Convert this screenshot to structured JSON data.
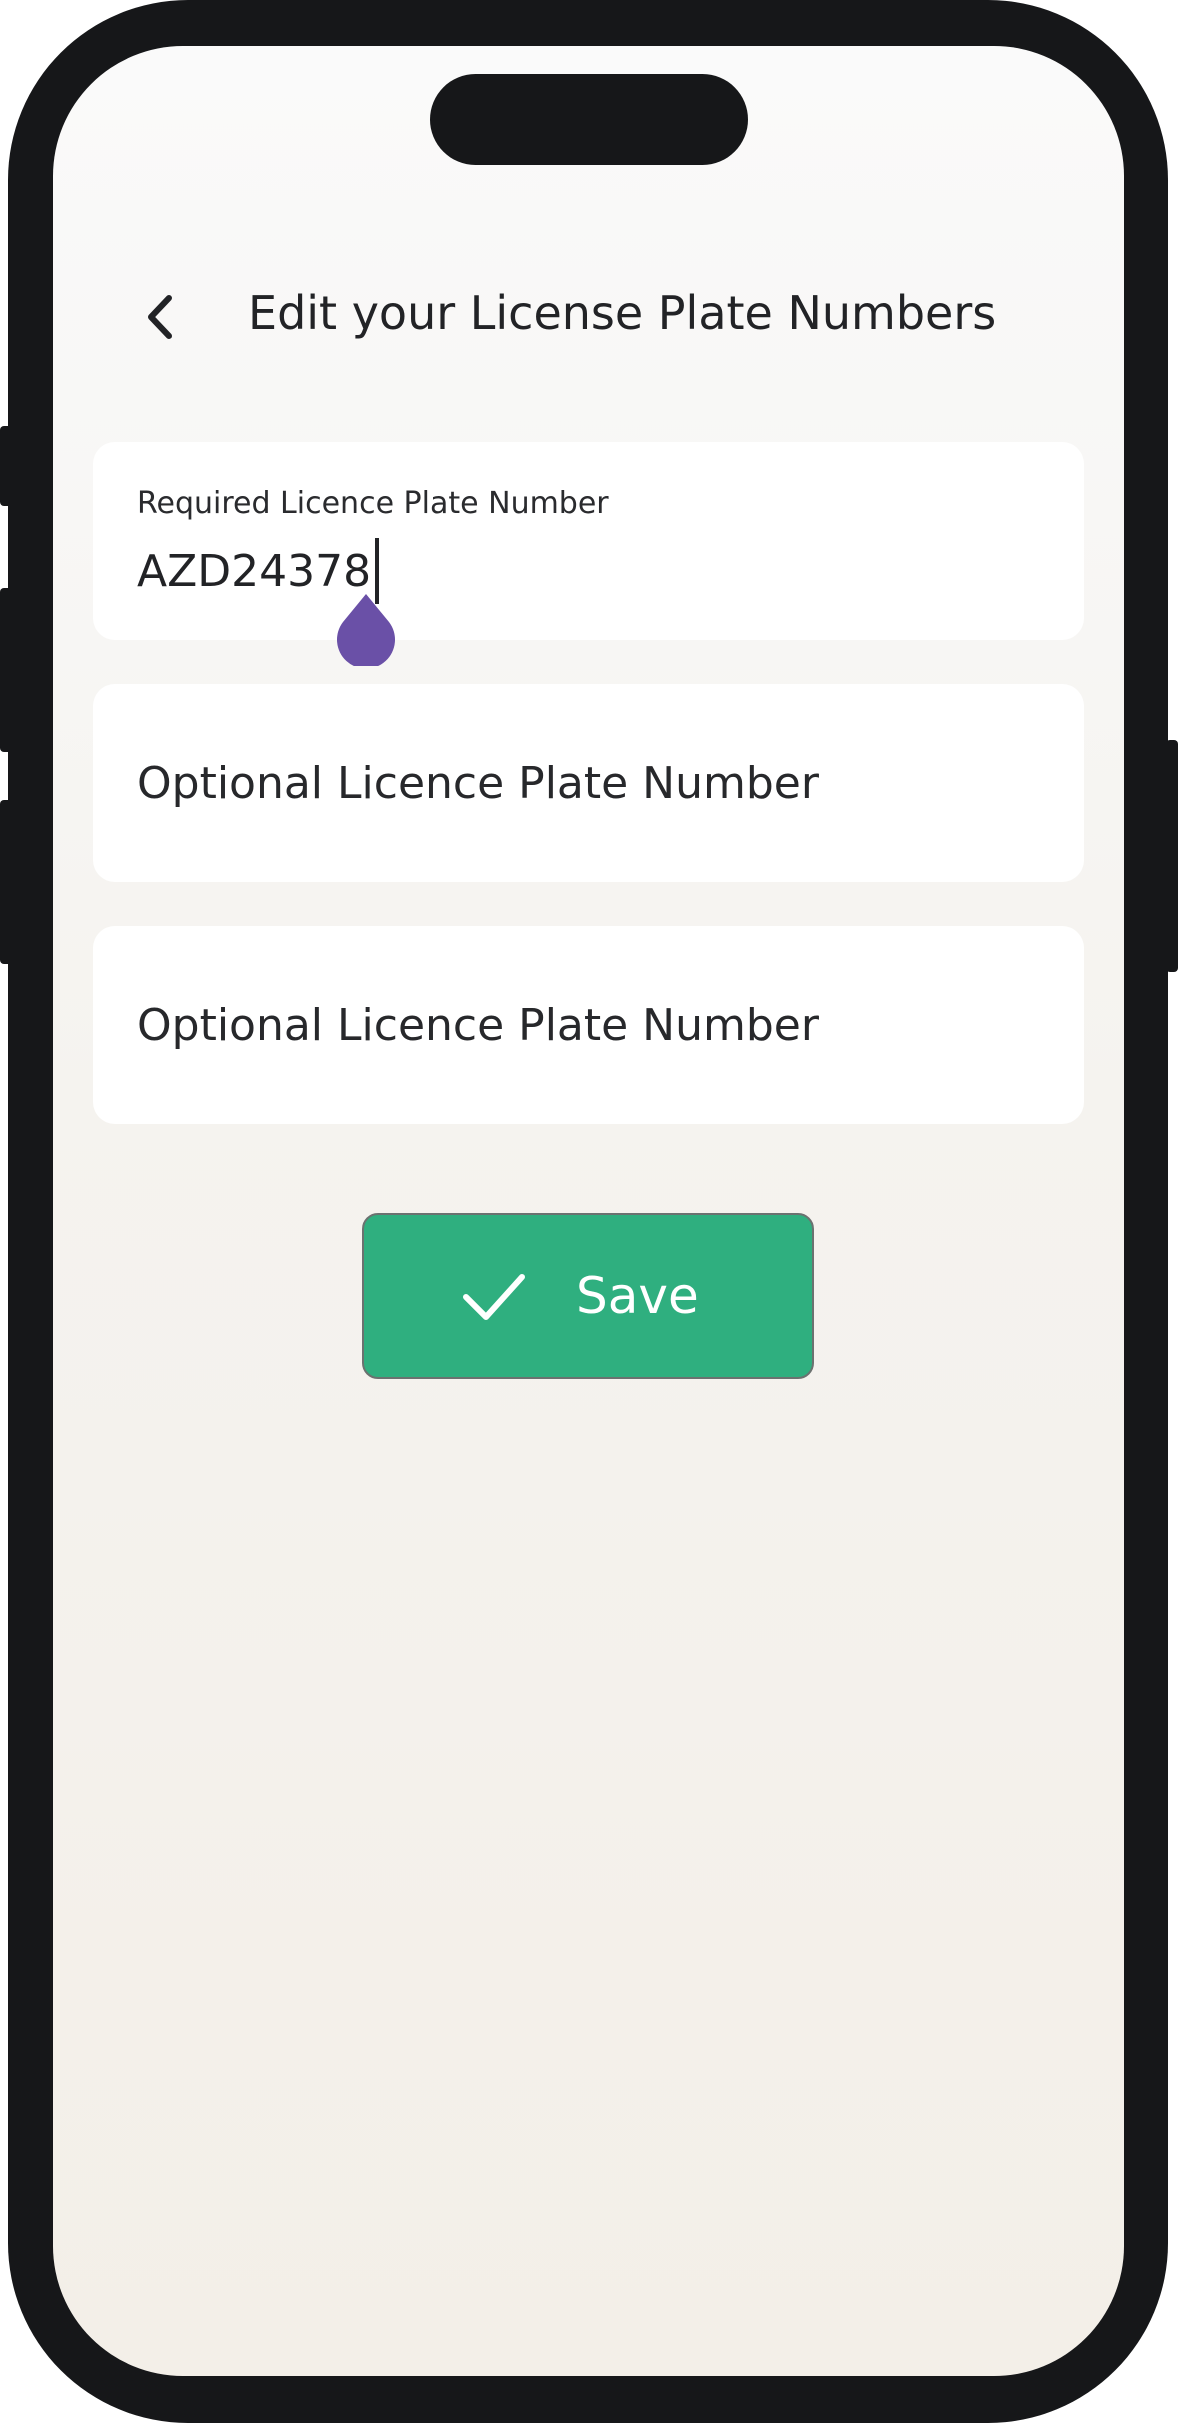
{
  "header": {
    "title": "Edit your License Plate Numbers",
    "back_icon": "chevron-left-icon"
  },
  "fields": {
    "required": {
      "label": "Required Licence Plate Number",
      "value": "AZD24378"
    },
    "optional_1": {
      "placeholder": "Optional Licence Plate Number",
      "value": ""
    },
    "optional_2": {
      "placeholder": "Optional Licence Plate Number",
      "value": ""
    }
  },
  "save_button": {
    "label": "Save",
    "icon": "checkmark-icon"
  },
  "colors": {
    "accent_green": "#2faf7f",
    "cursor_handle": "#6a50a7",
    "text_dark": "#222326",
    "device_frame": "#161719"
  }
}
